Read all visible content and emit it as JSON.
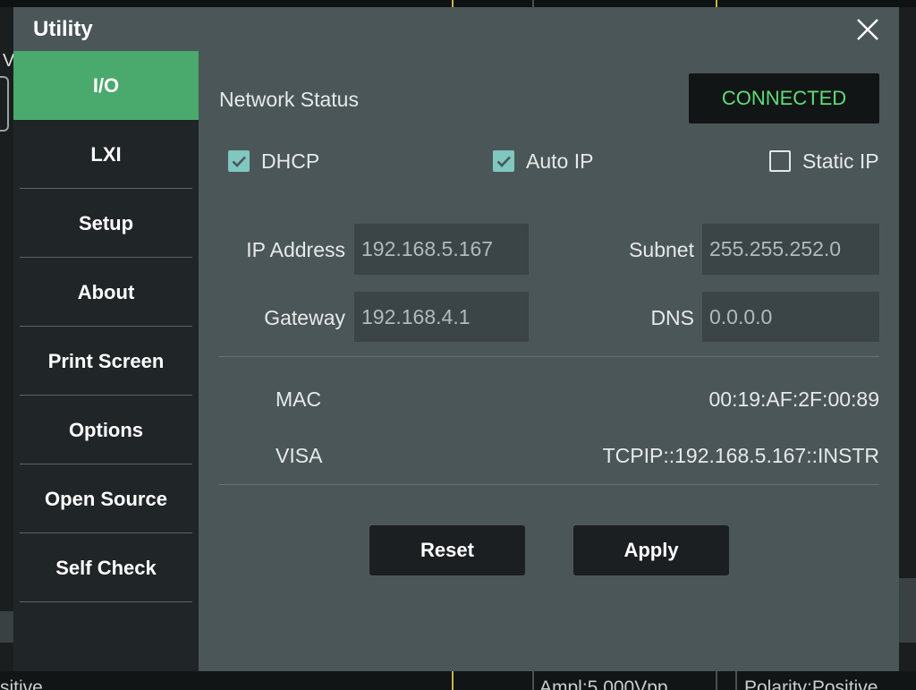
{
  "backdrop": {
    "left_glyph": "V",
    "bottom_left_text": "sitive",
    "bottom_mid_text": "Ampl:5.000Vpp",
    "bottom_right_text": "Polarity:Positive"
  },
  "dialog": {
    "title": "Utility"
  },
  "sidebar": {
    "items": [
      {
        "label": "I/O",
        "selected": true
      },
      {
        "label": "LXI"
      },
      {
        "label": "Setup"
      },
      {
        "label": "About"
      },
      {
        "label": "Print Screen"
      },
      {
        "label": "Options"
      },
      {
        "label": "Open Source"
      },
      {
        "label": "Self Check"
      }
    ]
  },
  "io": {
    "network_status_label": "Network Status",
    "network_status_value": "CONNECTED",
    "modes": [
      {
        "label": "DHCP",
        "checked": true
      },
      {
        "label": "Auto IP",
        "checked": true
      },
      {
        "label": "Static IP",
        "checked": false
      }
    ],
    "fields": {
      "ip_address": {
        "label": "IP Address",
        "value": "192.168.5.167"
      },
      "subnet": {
        "label": "Subnet",
        "value": "255.255.252.0"
      },
      "gateway": {
        "label": "Gateway",
        "value": "192.168.4.1"
      },
      "dns": {
        "label": "DNS",
        "value": "0.0.0.0"
      }
    },
    "mac": {
      "label": "MAC",
      "value": "00:19:AF:2F:00:89"
    },
    "visa": {
      "label": "VISA",
      "value": "TCPIP::192.168.5.167::INSTR"
    },
    "buttons": {
      "reset": "Reset",
      "apply": "Apply"
    }
  },
  "icons": {
    "close": "close-icon",
    "check": "check-icon"
  },
  "colors": {
    "selected_tab": "#4aa96c",
    "connected_text": "#5fdc79",
    "checkbox_checked": "#7fc8bf",
    "panel": "#4b5658",
    "sidebar": "#202527"
  }
}
